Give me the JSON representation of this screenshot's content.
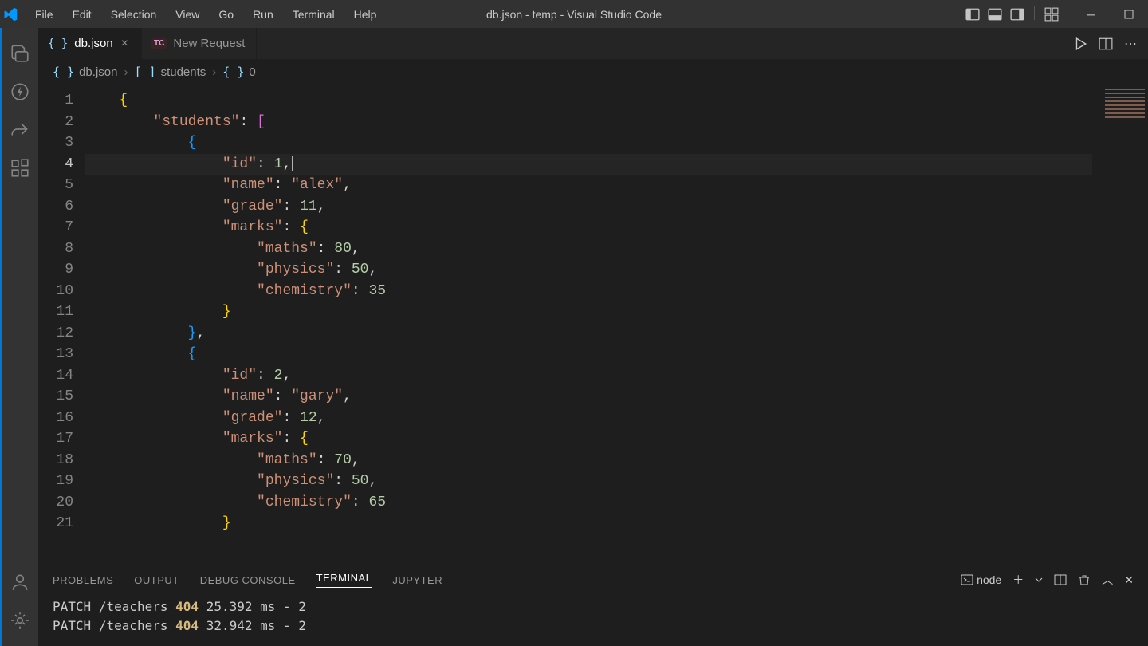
{
  "window_title": "db.json - temp - Visual Studio Code",
  "menu": [
    "File",
    "Edit",
    "Selection",
    "View",
    "Go",
    "Run",
    "Terminal",
    "Help"
  ],
  "tabs": [
    {
      "icon": "{ }",
      "label": "db.json",
      "active": true,
      "closable": true
    },
    {
      "icon": "TC",
      "label": "New Request",
      "active": false,
      "closable": false
    }
  ],
  "breadcrumb": [
    {
      "icon": "{ }",
      "label": "db.json"
    },
    {
      "icon": "[ ]",
      "label": "students"
    },
    {
      "icon": "{ }",
      "label": "0"
    }
  ],
  "editor": {
    "current_line": 4,
    "lines": [
      {
        "num": 1,
        "tokens": [
          [
            "",
            "    "
          ],
          [
            "br",
            "{"
          ]
        ]
      },
      {
        "num": 2,
        "tokens": [
          [
            "",
            "        "
          ],
          [
            "kr",
            "\"students\""
          ],
          [
            "p",
            ": "
          ],
          [
            "br2",
            "["
          ]
        ]
      },
      {
        "num": 3,
        "tokens": [
          [
            "",
            "            "
          ],
          [
            "br3",
            "{"
          ]
        ]
      },
      {
        "num": 4,
        "tokens": [
          [
            "",
            "                "
          ],
          [
            "kr",
            "\"id\""
          ],
          [
            "p",
            ": "
          ],
          [
            "n",
            "1"
          ],
          [
            "p",
            ","
          ]
        ],
        "cursor": true
      },
      {
        "num": 5,
        "tokens": [
          [
            "",
            "                "
          ],
          [
            "kr",
            "\"name\""
          ],
          [
            "p",
            ": "
          ],
          [
            "s",
            "\"alex\""
          ],
          [
            "p",
            ","
          ]
        ]
      },
      {
        "num": 6,
        "tokens": [
          [
            "",
            "                "
          ],
          [
            "kr",
            "\"grade\""
          ],
          [
            "p",
            ": "
          ],
          [
            "n",
            "11"
          ],
          [
            "p",
            ","
          ]
        ]
      },
      {
        "num": 7,
        "tokens": [
          [
            "",
            "                "
          ],
          [
            "kr",
            "\"marks\""
          ],
          [
            "p",
            ": "
          ],
          [
            "br",
            "{"
          ]
        ]
      },
      {
        "num": 8,
        "tokens": [
          [
            "",
            "                    "
          ],
          [
            "kr",
            "\"maths\""
          ],
          [
            "p",
            ": "
          ],
          [
            "n",
            "80"
          ],
          [
            "p",
            ","
          ]
        ]
      },
      {
        "num": 9,
        "tokens": [
          [
            "",
            "                    "
          ],
          [
            "kr",
            "\"physics\""
          ],
          [
            "p",
            ": "
          ],
          [
            "n",
            "50"
          ],
          [
            "p",
            ","
          ]
        ]
      },
      {
        "num": 10,
        "tokens": [
          [
            "",
            "                    "
          ],
          [
            "kr",
            "\"chemistry\""
          ],
          [
            "p",
            ": "
          ],
          [
            "n",
            "35"
          ]
        ]
      },
      {
        "num": 11,
        "tokens": [
          [
            "",
            "                "
          ],
          [
            "br",
            "}"
          ]
        ]
      },
      {
        "num": 12,
        "tokens": [
          [
            "",
            "            "
          ],
          [
            "br3",
            "}"
          ],
          [
            "p",
            ","
          ]
        ]
      },
      {
        "num": 13,
        "tokens": [
          [
            "",
            "            "
          ],
          [
            "br3",
            "{"
          ]
        ]
      },
      {
        "num": 14,
        "tokens": [
          [
            "",
            "                "
          ],
          [
            "kr",
            "\"id\""
          ],
          [
            "p",
            ": "
          ],
          [
            "n",
            "2"
          ],
          [
            "p",
            ","
          ]
        ]
      },
      {
        "num": 15,
        "tokens": [
          [
            "",
            "                "
          ],
          [
            "kr",
            "\"name\""
          ],
          [
            "p",
            ": "
          ],
          [
            "s",
            "\"gary\""
          ],
          [
            "p",
            ","
          ]
        ]
      },
      {
        "num": 16,
        "tokens": [
          [
            "",
            "                "
          ],
          [
            "kr",
            "\"grade\""
          ],
          [
            "p",
            ": "
          ],
          [
            "n",
            "12"
          ],
          [
            "p",
            ","
          ]
        ]
      },
      {
        "num": 17,
        "tokens": [
          [
            "",
            "                "
          ],
          [
            "kr",
            "\"marks\""
          ],
          [
            "p",
            ": "
          ],
          [
            "br",
            "{"
          ]
        ]
      },
      {
        "num": 18,
        "tokens": [
          [
            "",
            "                    "
          ],
          [
            "kr",
            "\"maths\""
          ],
          [
            "p",
            ": "
          ],
          [
            "n",
            "70"
          ],
          [
            "p",
            ","
          ]
        ]
      },
      {
        "num": 19,
        "tokens": [
          [
            "",
            "                    "
          ],
          [
            "kr",
            "\"physics\""
          ],
          [
            "p",
            ": "
          ],
          [
            "n",
            "50"
          ],
          [
            "p",
            ","
          ]
        ]
      },
      {
        "num": 20,
        "tokens": [
          [
            "",
            "                    "
          ],
          [
            "kr",
            "\"chemistry\""
          ],
          [
            "p",
            ": "
          ],
          [
            "n",
            "65"
          ]
        ]
      },
      {
        "num": 21,
        "tokens": [
          [
            "",
            "                "
          ],
          [
            "br",
            "}"
          ]
        ]
      }
    ]
  },
  "panel": {
    "tabs": [
      "PROBLEMS",
      "OUTPUT",
      "DEBUG CONSOLE",
      "TERMINAL",
      "JUPYTER"
    ],
    "active_tab": "TERMINAL",
    "shell_label": "node",
    "terminal_lines": [
      {
        "method": "PATCH",
        "path": "/teachers",
        "status": "404",
        "time": "25.392 ms",
        "tail": "- 2"
      },
      {
        "method": "PATCH",
        "path": "/teachers",
        "status": "404",
        "time": "32.942 ms",
        "tail": "- 2"
      }
    ]
  }
}
